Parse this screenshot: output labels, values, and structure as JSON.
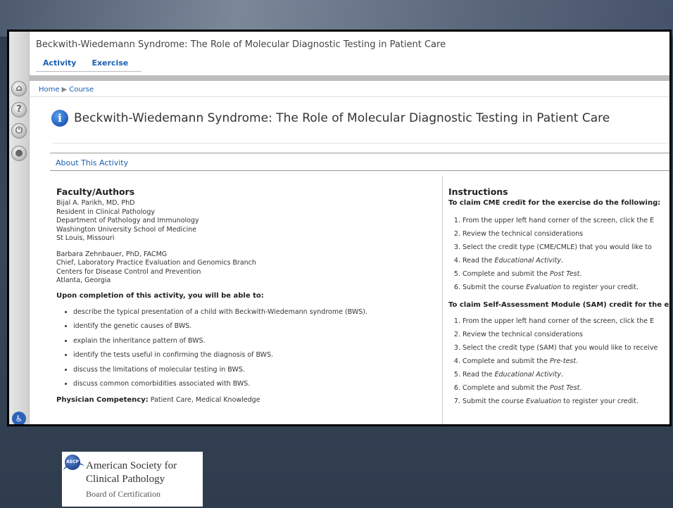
{
  "window": {
    "title": "Beckwith-Wiedemann Syndrome: The Role of Molecular Diagnostic Testing in Patient Care"
  },
  "nav": {
    "tabs": [
      {
        "label": "Activity"
      },
      {
        "label": "Exercise"
      }
    ]
  },
  "sidebar": {
    "buttons": [
      {
        "icon": "home-icon",
        "glyph": "⌂"
      },
      {
        "icon": "help-icon",
        "glyph": "?"
      },
      {
        "icon": "power-icon",
        "glyph": "⏻"
      },
      {
        "icon": "user-icon",
        "glyph": "●"
      }
    ],
    "accessibility_label": "508"
  },
  "breadcrumb": {
    "home": "Home",
    "separator": "▶",
    "current": "Course"
  },
  "main": {
    "title": "Beckwith-Wiedemann Syndrome: The Role of Molecular Diagnostic Testing in Patient Care",
    "info_glyph": "i",
    "panel_heading": "About This Activity"
  },
  "faculty": {
    "heading": "Faculty/Authors",
    "author1": [
      "Bijal A. Parikh, MD, PhD",
      "Resident in Clinical Pathology",
      "Department of Pathology and Immunology",
      "Washington University School of Medicine",
      "St Louis, Missouri"
    ],
    "author2": [
      "Barbara Zehnbauer, PhD, FACMG",
      "Chief, Laboratory Practice Evaluation and Genomics Branch",
      "Centers for Disease Control and Prevention",
      "Atlanta, Georgia"
    ],
    "objectives_heading": "Upon completion of this activity, you will be able to:",
    "objectives": [
      "describe the typical presentation of a child with Beckwith-Wiedemann syndrome (BWS).",
      "identify the genetic causes of BWS.",
      "explain the inheritance pattern of BWS.",
      "identify the tests useful in confirming the diagnosis of BWS.",
      "discuss the limitations of molecular testing in BWS.",
      "discuss common comorbidities associated with BWS."
    ],
    "competency_label": "Physician Competency:",
    "competency_value": "Patient Care, Medical Knowledge"
  },
  "instructions": {
    "heading": "Instructions",
    "cme_heading": "To claim CME credit for the exercise do the following:",
    "cme_steps": [
      {
        "pre": "From the upper left hand corner of the screen, click the E",
        "em": "",
        "post": ""
      },
      {
        "pre": "Review the technical considerations",
        "em": "",
        "post": ""
      },
      {
        "pre": "Select the credit type (CME/CMLE) that you would like to",
        "em": "",
        "post": ""
      },
      {
        "pre": "Read the ",
        "em": "Educational Activity",
        "post": "."
      },
      {
        "pre": "Complete and submit the ",
        "em": "Post Test",
        "post": "."
      },
      {
        "pre": "Submit the course ",
        "em": "Evaluation",
        "post": " to register your credit."
      }
    ],
    "sam_heading": "To claim Self-Assessment Module (SAM) credit for the ex",
    "sam_steps": [
      {
        "pre": "From the upper left hand corner of the screen, click the E",
        "em": "",
        "post": ""
      },
      {
        "pre": "Review the technical considerations",
        "em": "",
        "post": ""
      },
      {
        "pre": "Select the credit type (SAM) that you would like to receive",
        "em": "",
        "post": ""
      },
      {
        "pre": "Complete and submit the ",
        "em": "Pre-test",
        "post": "."
      },
      {
        "pre": "Read the ",
        "em": "Educational Activity",
        "post": "."
      },
      {
        "pre": "Complete and submit the ",
        "em": "Post Test",
        "post": "."
      },
      {
        "pre": "Submit the course ",
        "em": "Evaluation",
        "post": " to register your credit."
      }
    ]
  },
  "footer_logo": {
    "badge": "ASCP",
    "line1": "American Society for",
    "line2": "Clinical Pathology",
    "line3": "Board of Certification"
  }
}
